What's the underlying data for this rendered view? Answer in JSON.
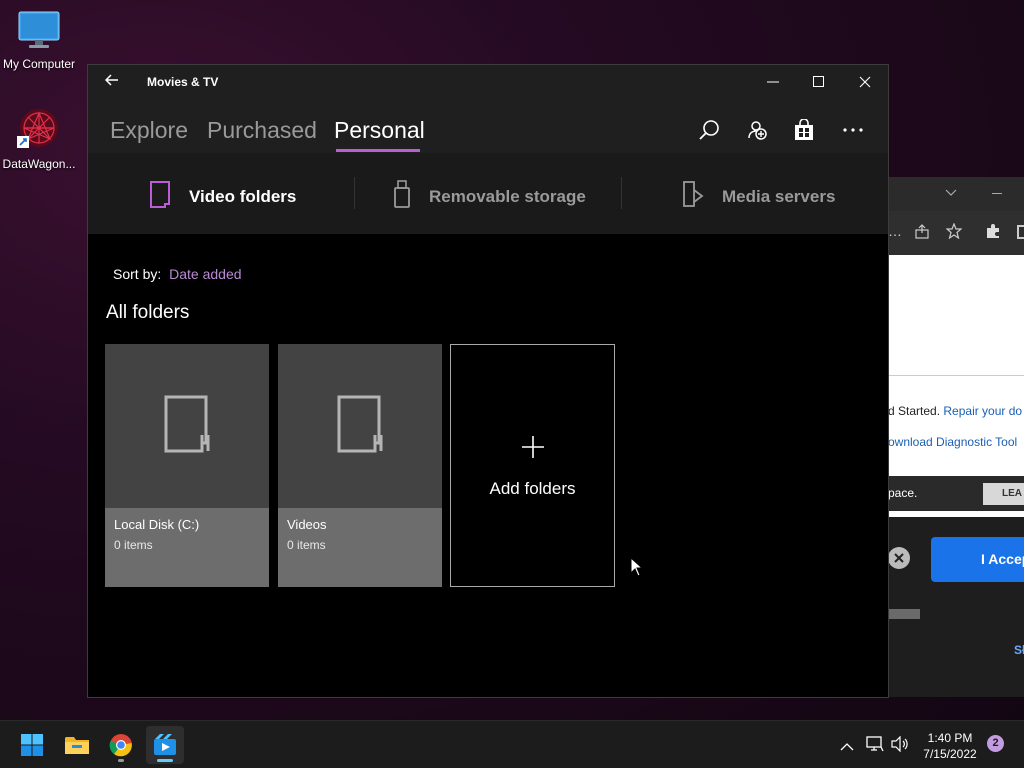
{
  "desktop": {
    "icons": [
      {
        "label": "My Computer",
        "icon": "monitor-icon"
      },
      {
        "label": "DataWagon...",
        "icon": "datawagon-shortcut-icon"
      }
    ]
  },
  "background_browser": {
    "text_lines": [
      "d Started.",
      "Repair your do",
      "ownload Diagnostic Tool",
      "pace.",
      "LEA",
      "I Accep",
      "Sł"
    ]
  },
  "app": {
    "title": "Movies & TV",
    "tabs": [
      {
        "label": "Explore",
        "active": false
      },
      {
        "label": "Purchased",
        "active": false
      },
      {
        "label": "Personal",
        "active": true
      }
    ],
    "nav_icons": [
      "search-icon",
      "add-person-icon",
      "store-icon",
      "more-icon"
    ],
    "subtabs": [
      {
        "label": "Video folders",
        "icon": "folder-icon",
        "active": true
      },
      {
        "label": "Removable storage",
        "icon": "usb-icon",
        "active": false
      },
      {
        "label": "Media servers",
        "icon": "media-server-icon",
        "active": false
      }
    ],
    "sort_label": "Sort by:",
    "sort_value": "Date added",
    "section_title": "All folders",
    "folders": [
      {
        "title": "Local Disk (C:)",
        "count": "0 items"
      },
      {
        "title": "Videos",
        "count": "0 items"
      }
    ],
    "add_folders_label": "Add folders",
    "accent_color": "#b75fd3"
  },
  "taskbar": {
    "apps": [
      "windows-start-icon",
      "file-explorer-icon",
      "chrome-icon",
      "movies-tv-icon"
    ],
    "time": "1:40 PM",
    "date": "7/15/2022",
    "notification_count": "2"
  }
}
